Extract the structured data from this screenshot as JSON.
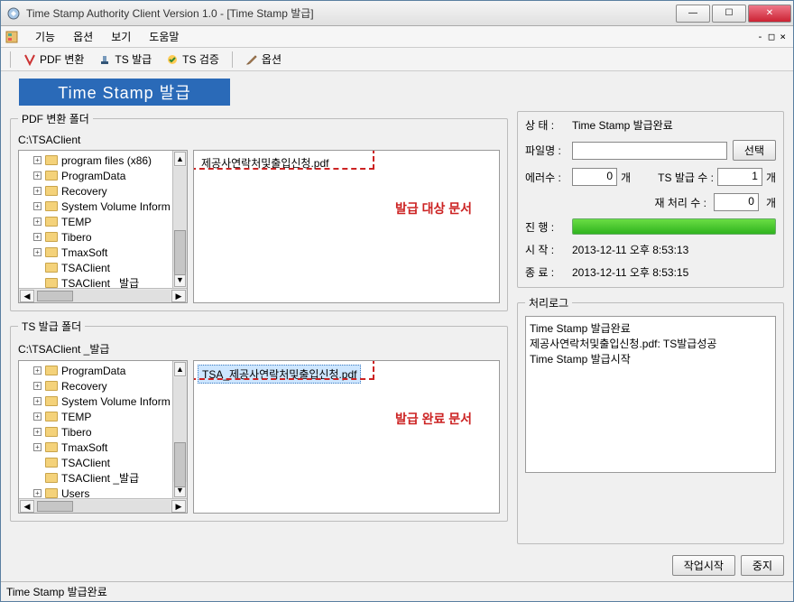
{
  "window": {
    "title": "Time Stamp Authority Client Version 1.0 - [Time Stamp 발급]"
  },
  "menubar": {
    "items": [
      "기능",
      "옵션",
      "보기",
      "도움말"
    ]
  },
  "toolbar": {
    "pdf_convert": "PDF 변환",
    "ts_issue": "TS 발급",
    "ts_verify": "TS 검증",
    "options": "옵션"
  },
  "banner": "Time Stamp 발급",
  "pdf_folder": {
    "legend": "PDF 변환 폴더",
    "path": "C:\\TSAClient",
    "tree": [
      {
        "name": "program files (x86)",
        "exp": true
      },
      {
        "name": "ProgramData",
        "exp": true
      },
      {
        "name": "Recovery",
        "exp": true
      },
      {
        "name": "System Volume Inform",
        "exp": true
      },
      {
        "name": "TEMP",
        "exp": true
      },
      {
        "name": "Tibero",
        "exp": true
      },
      {
        "name": "TmaxSoft",
        "exp": true
      },
      {
        "name": "TSAClient",
        "exp": false
      },
      {
        "name": "TSAClient _발급",
        "exp": false
      }
    ],
    "file": "제공사연락처및출입신청.pdf",
    "annotation": "발급 대상 문서"
  },
  "ts_folder": {
    "legend": "TS 발급 폴더",
    "path": "C:\\TSAClient _발급",
    "tree": [
      {
        "name": "ProgramData",
        "exp": true
      },
      {
        "name": "Recovery",
        "exp": true
      },
      {
        "name": "System Volume Inform",
        "exp": true
      },
      {
        "name": "TEMP",
        "exp": true
      },
      {
        "name": "Tibero",
        "exp": true
      },
      {
        "name": "TmaxSoft",
        "exp": true
      },
      {
        "name": "TSAClient",
        "exp": false
      },
      {
        "name": "TSAClient _발급",
        "exp": false
      },
      {
        "name": "Users",
        "exp": true
      }
    ],
    "file": "TSA_제공사연락처및출입신청.pdf",
    "annotation": "발급 완료 문서"
  },
  "status": {
    "state_label": "상 태 :",
    "state_value": "Time Stamp 발급완료",
    "file_label": "파일명 :",
    "select_btn": "선택",
    "error_label": "에러수 :",
    "error_count": "0",
    "count_unit": "개",
    "issue_label": "TS 발급 수 :",
    "issue_count": "1",
    "retry_label": "재 처리 수 :",
    "retry_count": "0",
    "progress_label": "진 행 :",
    "start_label": "시 작 :",
    "start_value": "2013-12-11 오후 8:53:13",
    "end_label": "종 료 :",
    "end_value": "2013-12-11 오후 8:53:15"
  },
  "log": {
    "legend": "처리로그",
    "lines": [
      "Time Stamp 발급완료",
      "제공사연락처및출입신청.pdf: TS발급성공",
      "Time Stamp 발급시작"
    ]
  },
  "buttons": {
    "start": "작업시작",
    "stop": "중지"
  },
  "statusbar": "Time Stamp 발급완료"
}
